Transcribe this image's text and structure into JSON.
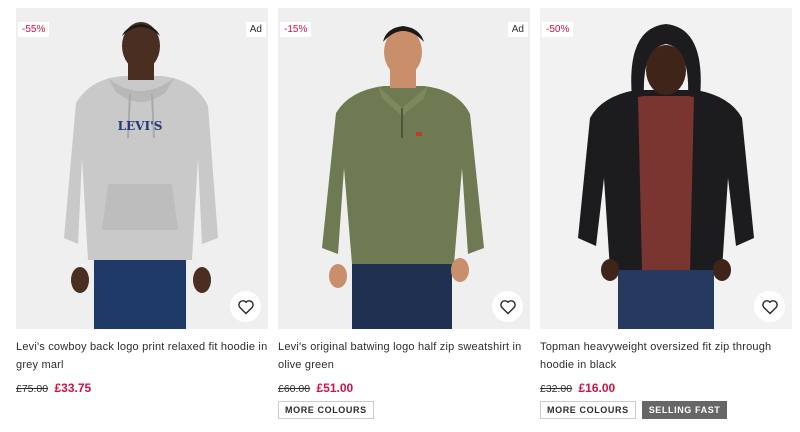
{
  "products": [
    {
      "discount": "-55%",
      "ad": "Ad",
      "title_line1": "Levi's cowboy back logo print relaxed fit hoodie in",
      "title_line2": "grey marl",
      "was_price": "£75.00",
      "now_price": "£33.75",
      "tags": []
    },
    {
      "discount": "-15%",
      "ad": "Ad",
      "title_line1": "Levi's original batwing logo half zip sweatshirt in",
      "title_line2": "olive green",
      "was_price": "£60.00",
      "now_price": "£51.00",
      "tags": [
        "MORE COLOURS"
      ]
    },
    {
      "discount": "-50%",
      "ad": "",
      "title_line1": "Topman heavyweight oversized fit zip through",
      "title_line2": "hoodie in black",
      "was_price": "£32.00",
      "now_price": "£16.00",
      "tags": [
        "MORE COLOURS",
        "SELLING FAST"
      ]
    }
  ],
  "print_on_hoodie": "LEVI'S",
  "colors": {
    "sale": "#d01345",
    "text": "#2d2d2d",
    "image_bg": "#efefef",
    "tag_dark": "#666666"
  }
}
